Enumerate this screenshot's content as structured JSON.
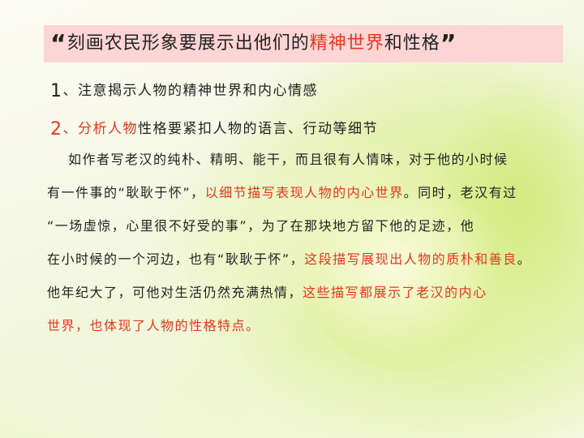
{
  "slide": {
    "title": {
      "open_quote": "“",
      "part1": "刻画农民形象要展示出他们的",
      "highlight": "精神世界",
      "part2": "和性格",
      "close_quote": "”"
    },
    "point1": {
      "num": "1",
      "text": "、注意揭示人物的精神世界和内心情感"
    },
    "point2": {
      "num": "2",
      "red": "、分析人物",
      "text": "性格要紧扣人物的语言、行动等细节"
    },
    "paragraph": {
      "l1": "如作者写老汉的纯朴、精明、能干，而且很有人情味，对于他的小时候",
      "l2_a": "有一件事的",
      "l2_q1": "“",
      "l2_q": "耿耿于怀",
      "l2_q2": "”",
      "l2_b": "，",
      "l2_red": "以细节描写表现人物的内心世界",
      "l2_c": "。同时，老汉有过",
      "l3_q1": "“",
      "l3_q": "一场虚惊，心里很不好受的事",
      "l3_q2": "”",
      "l3_a": "，为了在那块地方留下他的足迹，他",
      "l4_a": "在小时候的一个河边，也有",
      "l4_q1": "“",
      "l4_q": "耿耿于怀",
      "l4_q2": "”",
      "l4_b": "，",
      "l4_red": "这段描写展现出人物的质朴和善良",
      "l4_c": "。",
      "l5_a": "他年纪大了，可他对生活仍然充满热情，",
      "l5_red": "这些描写都展示了老汉的内心",
      "l6_red": "世界，也体现了人物的性格特点。"
    },
    "colors": {
      "highlight": "#e8361e",
      "title_bg": "#fdd5d5",
      "text": "#222222"
    }
  }
}
